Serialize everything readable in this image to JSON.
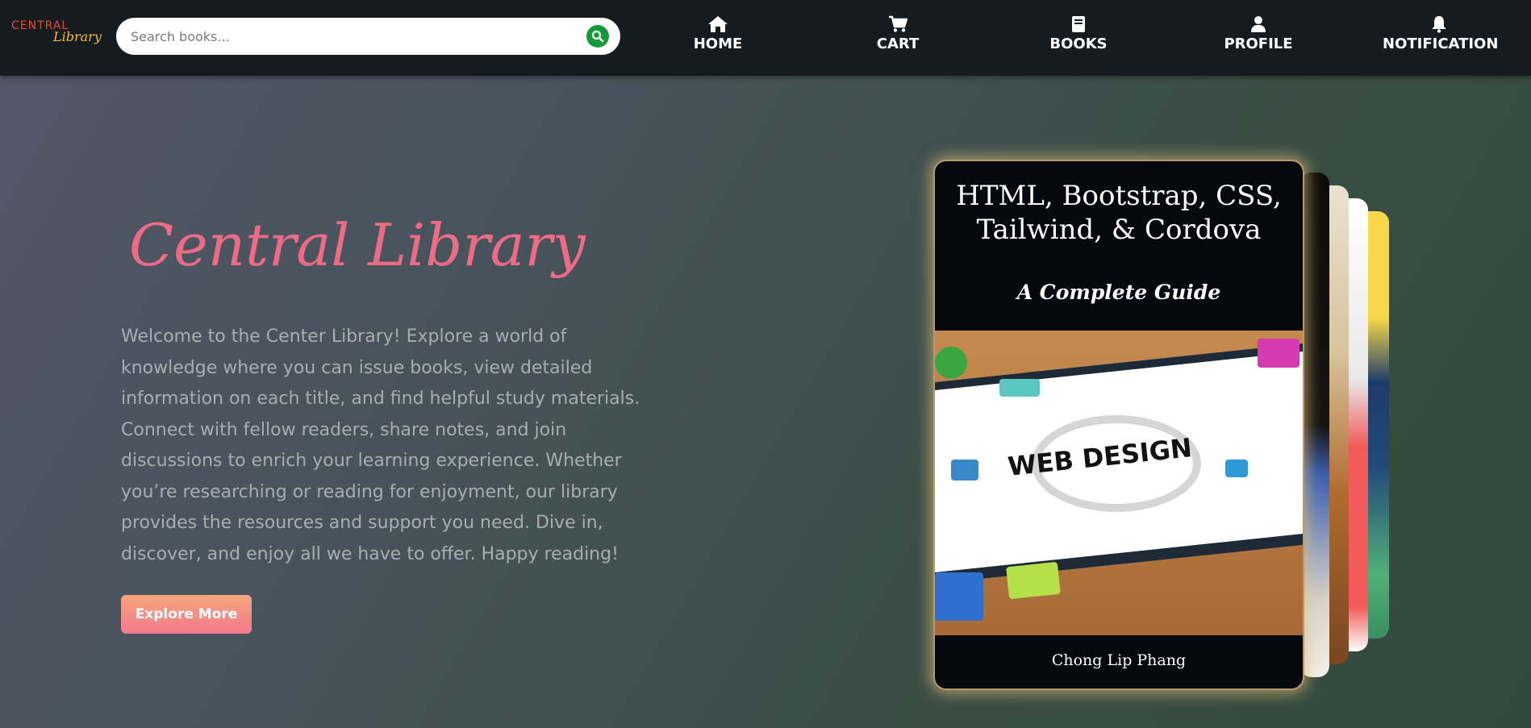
{
  "navbar": {
    "logo_top": "CENTRAL",
    "logo_bottom": "Library",
    "search_placeholder": "Search books...",
    "items": [
      {
        "label": "HOME",
        "icon": "home-icon"
      },
      {
        "label": "CART",
        "icon": "cart-icon"
      },
      {
        "label": "BOOKS",
        "icon": "book-icon"
      },
      {
        "label": "PROFILE",
        "icon": "user-icon"
      },
      {
        "label": "NOTIFICATION",
        "icon": "bell-icon"
      }
    ]
  },
  "hero": {
    "title": "Central Library",
    "description": "Welcome to the Center Library! Explore a world of knowledge where you can issue books, view detailed information on each title, and find helpful study materials. Connect with fellow readers, share notes, and join discussions to enrich your learning experience. Whether you’re researching or reading for enjoyment, our library provides the resources and support you need. Dive in, discover, and enjoy all we have to offer. Happy reading!",
    "button_label": "Explore More"
  },
  "featured_book": {
    "title_line1": "HTML, Bootstrap, CSS,",
    "title_line2": "Tailwind, & Cordova",
    "subtitle": "A Complete Guide",
    "art_text": "WEB DESIGN",
    "author": "Chong Lip Phang"
  },
  "colors": {
    "navbar_bg": "#161b1f",
    "title_pink": "#ee6b86",
    "search_button": "#159a3a",
    "button_gradient_top": "#f6a67e",
    "button_gradient_bottom": "#f37a8d"
  }
}
